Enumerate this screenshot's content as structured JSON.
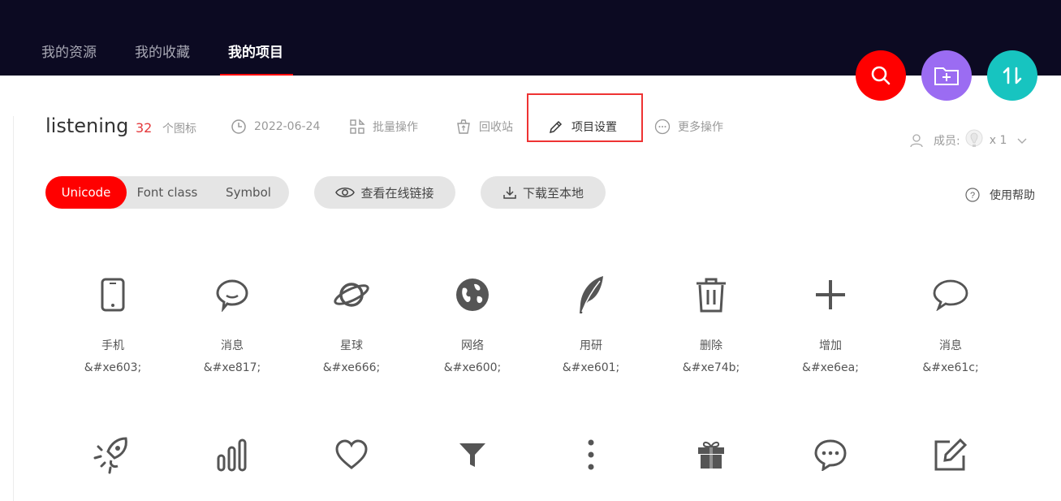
{
  "nav": {
    "tabs": [
      {
        "label": "我的资源"
      },
      {
        "label": "我的收藏"
      },
      {
        "label": "我的项目"
      }
    ]
  },
  "fabs": {
    "search": {
      "icon": "search-icon",
      "color": "#ff0000"
    },
    "new_folder": {
      "icon": "folder-plus-icon",
      "color": "#9b6cf2"
    },
    "sort": {
      "icon": "sort-icon",
      "color": "#17c4c0"
    }
  },
  "project": {
    "title": "listening",
    "icon_count": "32",
    "icon_count_label": "个图标",
    "date": "2022-06-24",
    "batch": "批量操作",
    "recycle": "回收站",
    "settings": "项目设置",
    "more": "更多操作",
    "members_label": "成员:",
    "members_count": "x 1"
  },
  "tabs": {
    "unicode": "Unicode",
    "font_class": "Font class",
    "symbol": "Symbol"
  },
  "actions": {
    "view_online": "查看在线链接",
    "download": "下载至本地",
    "help": "使用帮助"
  },
  "icons_row1": [
    {
      "name": "手机",
      "code": "&#xe603;",
      "icon": "phone-icon"
    },
    {
      "name": "消息",
      "code": "&#xe817;",
      "icon": "chat-bubble-icon"
    },
    {
      "name": "星球",
      "code": "&#xe666;",
      "icon": "planet-icon"
    },
    {
      "name": "网络",
      "code": "&#xe600;",
      "icon": "globe-icon"
    },
    {
      "name": "用研",
      "code": "&#xe601;",
      "icon": "feather-icon"
    },
    {
      "name": "删除",
      "code": "&#xe74b;",
      "icon": "trash-icon"
    },
    {
      "name": "增加",
      "code": "&#xe6ea;",
      "icon": "plus-icon"
    },
    {
      "name": "消息",
      "code": "&#xe61c;",
      "icon": "speech-bubble-icon"
    }
  ],
  "icons_row2": [
    {
      "icon": "rocket-icon"
    },
    {
      "icon": "bars-icon"
    },
    {
      "icon": "heart-icon"
    },
    {
      "icon": "filter-icon"
    },
    {
      "icon": "more-vertical-icon"
    },
    {
      "icon": "gift-icon"
    },
    {
      "icon": "chat-dots-icon"
    },
    {
      "icon": "edit-icon"
    }
  ]
}
